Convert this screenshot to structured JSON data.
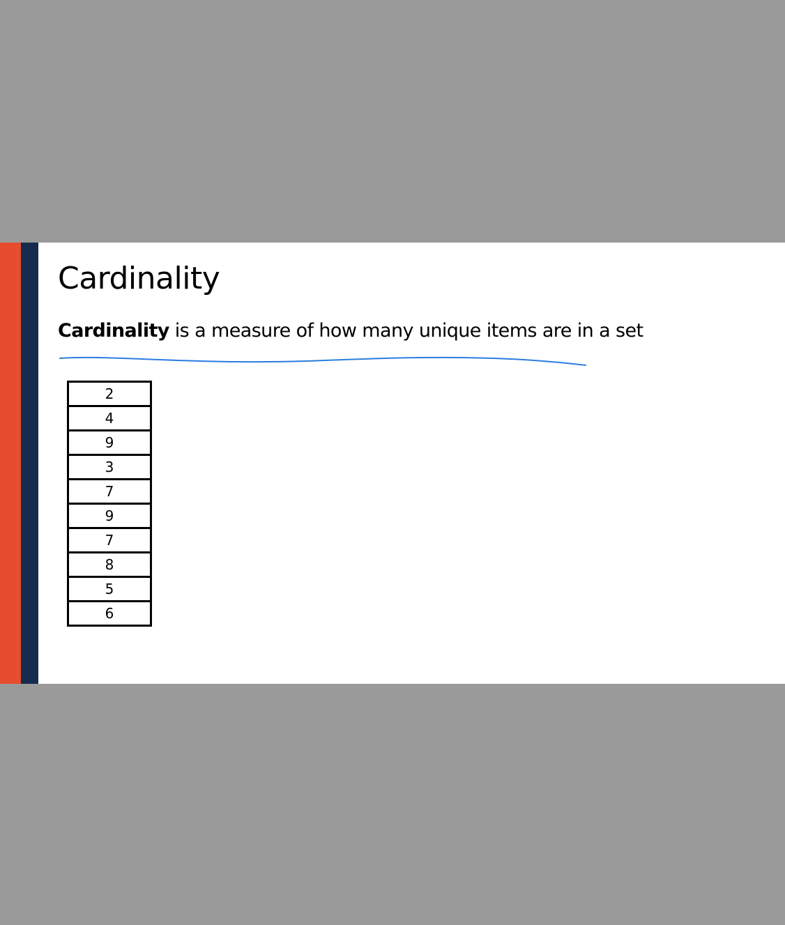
{
  "slide": {
    "title": "Cardinality",
    "definition": {
      "term": "Cardinality",
      "rest": " is a measure of how many unique items are in a set"
    },
    "colors": {
      "accent_orange": "#e54d2e",
      "accent_navy": "#162b4d",
      "ink_underline": "#2b7de0",
      "backdrop": "#9a9a9a"
    },
    "set_values": [
      "2",
      "4",
      "9",
      "3",
      "7",
      "9",
      "7",
      "8",
      "5",
      "6"
    ]
  }
}
